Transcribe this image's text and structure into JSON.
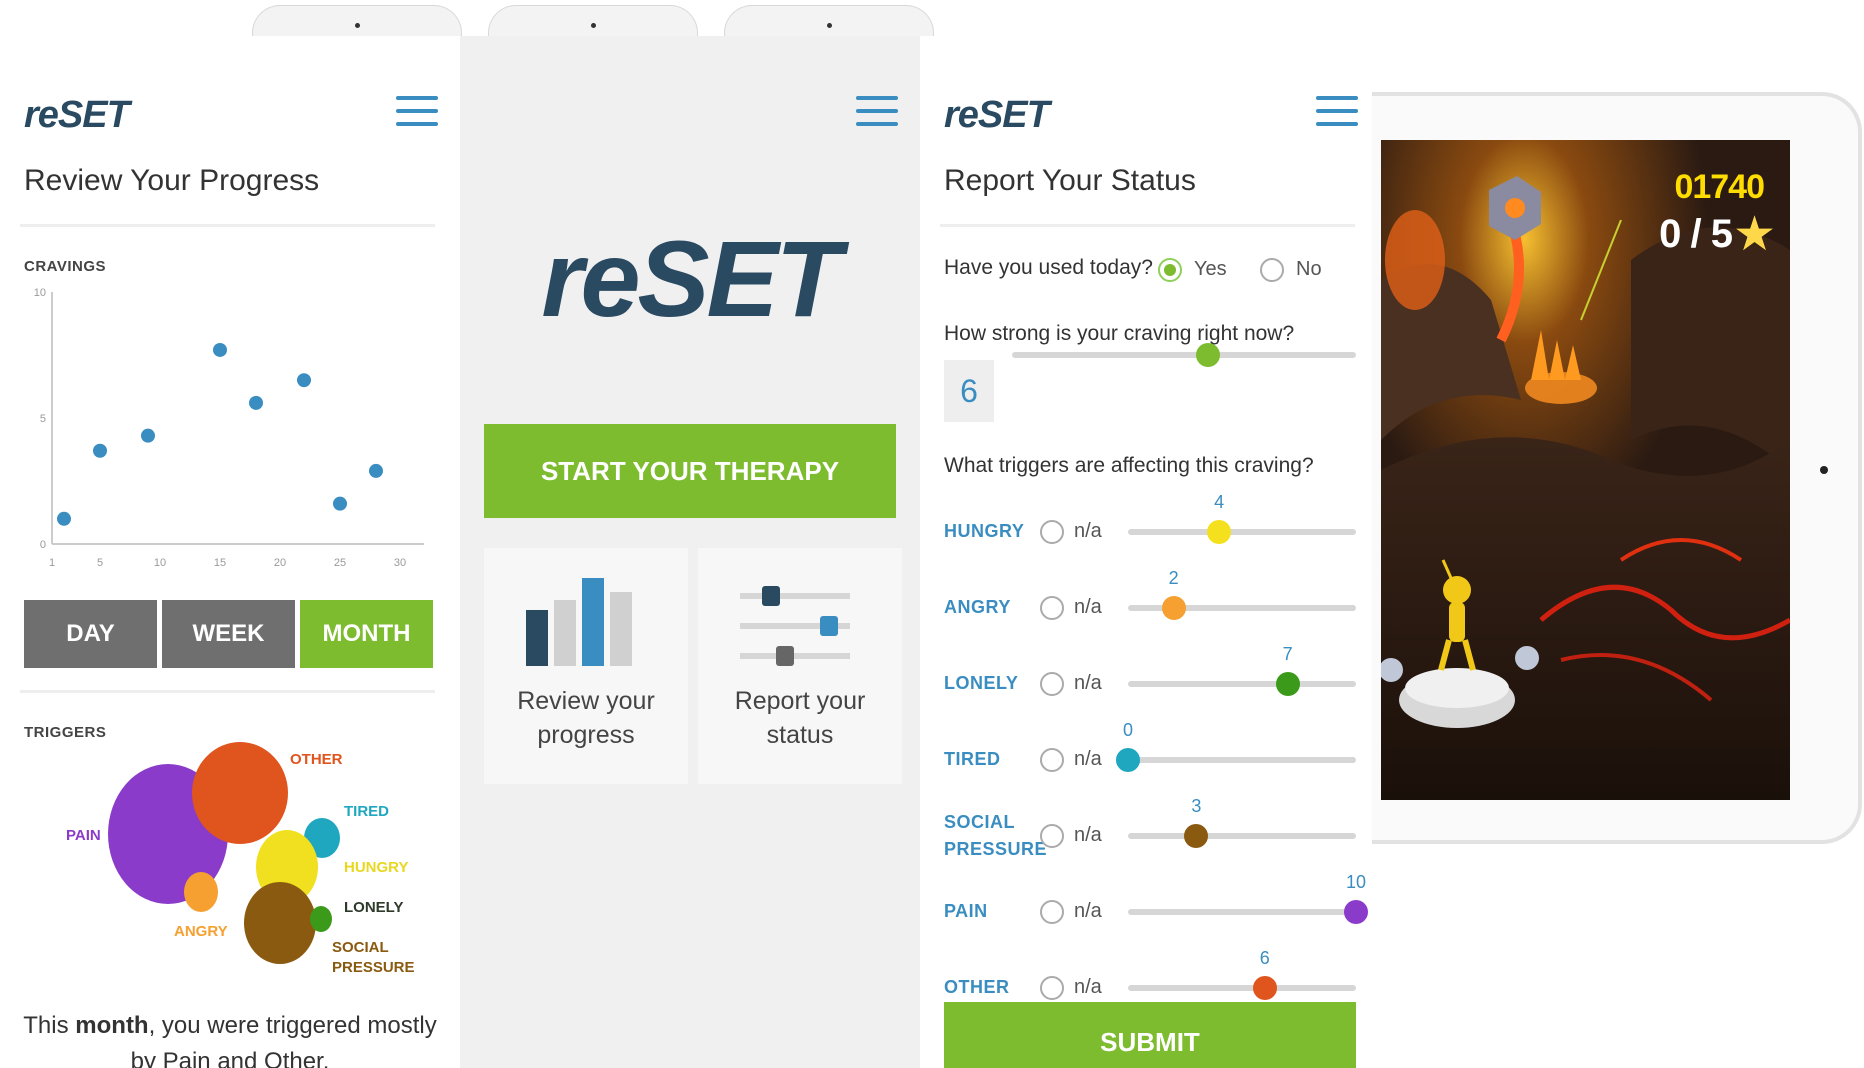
{
  "screen1": {
    "logo": "reSET",
    "title": "Review Your Progress",
    "cravings_label": "CRAVINGS",
    "tabs": [
      "DAY",
      "WEEK",
      "MONTH"
    ],
    "active_tab": "MONTH",
    "triggers_label": "TRIGGERS",
    "bubbles": [
      {
        "label": "PAIN",
        "color": "#8b3bc9"
      },
      {
        "label": "OTHER",
        "color": "#e0541e"
      },
      {
        "label": "TIRED",
        "color": "#1fa7c0"
      },
      {
        "label": "HUNGRY",
        "color": "#f0e020"
      },
      {
        "label": "LONELY",
        "color": "#3c9a1a"
      },
      {
        "label": "ANGRY",
        "color": "#f5a030"
      },
      {
        "label": "SOCIAL PRESSURE",
        "color": "#8a5a10"
      }
    ],
    "summary_pre": "This ",
    "summary_bold": "month",
    "summary_post": ", you were triggered mostly by Pain and Other."
  },
  "chart_data": {
    "type": "scatter",
    "title": "CRAVINGS",
    "xlabel": "",
    "ylabel": "",
    "x_ticks": [
      1,
      5,
      10,
      15,
      20,
      25,
      30
    ],
    "y_ticks": [
      0,
      5,
      10
    ],
    "xlim": [
      1,
      32
    ],
    "ylim": [
      0,
      10
    ],
    "points": [
      {
        "x": 2,
        "y": 1
      },
      {
        "x": 5,
        "y": 3.7
      },
      {
        "x": 9,
        "y": 4.3
      },
      {
        "x": 15,
        "y": 7.7
      },
      {
        "x": 18,
        "y": 5.6
      },
      {
        "x": 22,
        "y": 6.5
      },
      {
        "x": 25,
        "y": 1.6
      },
      {
        "x": 28,
        "y": 2.9
      }
    ]
  },
  "screen2": {
    "logo": "reSET",
    "start_label": "START YOUR THERAPY",
    "card1_label": "Review your progress",
    "card2_label": "Report your status"
  },
  "screen3": {
    "logo": "reSET",
    "title": "Report Your Status",
    "used_question": "Have you used today?",
    "yes_label": "Yes",
    "no_label": "No",
    "used_answer": "Yes",
    "craving_question": "How strong is your craving right now?",
    "craving_value": "6",
    "craving_fraction": 0.57,
    "triggers_question": "What triggers are affecting this craving?",
    "na_label": "n/a",
    "triggers": [
      {
        "name": "HUNGRY",
        "value": 4,
        "color": "#f4e01c"
      },
      {
        "name": "ANGRY",
        "value": 2,
        "color": "#f5a030"
      },
      {
        "name": "LONELY",
        "value": 7,
        "color": "#3c9a1a"
      },
      {
        "name": "TIRED",
        "value": 0,
        "color": "#1fa7c0"
      },
      {
        "name": "SOCIAL PRESSURE",
        "value": 3,
        "color": "#8a5a10"
      },
      {
        "name": "PAIN",
        "value": 10,
        "color": "#8b3bc9"
      },
      {
        "name": "OTHER",
        "value": 6,
        "color": "#e0541e"
      }
    ],
    "submit_label": "SUBMIT"
  },
  "game": {
    "score": "01740",
    "stars": "0 / 5"
  },
  "colors": {
    "brand_navy": "#2a4a62",
    "accent_green": "#7dbb2f",
    "link_blue": "#3a8dc0",
    "tab_gray": "#6f6f6f"
  }
}
